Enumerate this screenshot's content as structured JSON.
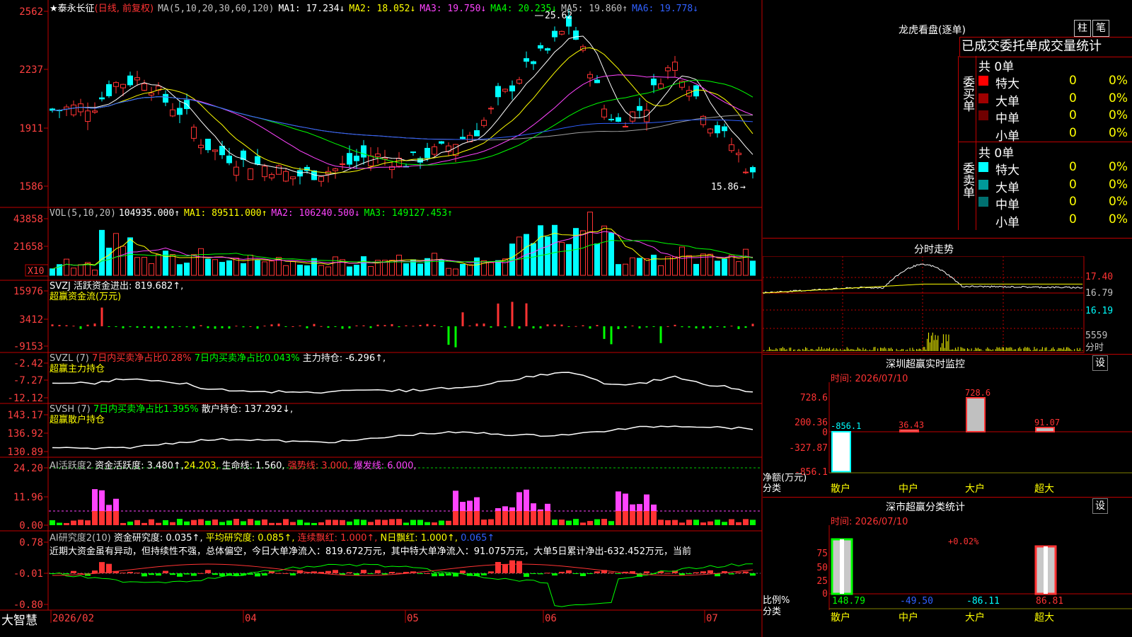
{
  "colors": {
    "up": "#ff3333",
    "down": "#00ffff",
    "grid": "#c00000",
    "yellow": "#ffff00",
    "magenta": "#ff44ff",
    "green": "#00ff00",
    "white": "#ffffff",
    "blue": "#3060ff",
    "gray": "#a0a0a0"
  },
  "header": {
    "stock": "★泰永长征",
    "period": "(日线, 前复权)",
    "ma_params": "MA(5,10,20,30,60,120)",
    "ma1": "MA1: 17.234↓",
    "ma2": "MA2: 18.052↓",
    "ma3": "MA3: 19.750↓",
    "ma4": "MA4: 20.235↓",
    "ma5": "MA5: 19.860↑",
    "ma6": "MA6: 19.778↓"
  },
  "price_axis": [
    "2562",
    "2237",
    "1911",
    "1586"
  ],
  "price_marks": {
    "high": "25.62",
    "low": "15.86"
  },
  "vol": {
    "axis": [
      "43858",
      "21658"
    ],
    "unit": "X10",
    "title": "VOL(5,10,20)",
    "v": "104935.000↑",
    "ma1": "MA1: 89511.000↑",
    "ma2": "MA2: 106240.500↓",
    "ma3": "MA3: 149127.453↑"
  },
  "svzj": {
    "axis": [
      "15976",
      "3412",
      "-9153"
    ],
    "line1": "SVZJ  活跃资金进出: 819.682↑,",
    "line2": "超赢资金流(万元)"
  },
  "svzl": {
    "axis": [
      "-2.42",
      "-7.27",
      "-12.12"
    ],
    "p1": "SVZL (7)",
    "p2": "7日内买卖净占比0.28%",
    "p3": "7日内买卖净占比0.043%",
    "p4": "主力持仓: -6.296↑,",
    "line2": "超赢主力持仓"
  },
  "svsh": {
    "axis": [
      "143.17",
      "136.92",
      "130.89"
    ],
    "p1": "SVSH (7)",
    "p2": "7日内买卖净占比1.395%",
    "p3": "散户持仓: 137.292↓,",
    "line2": "超赢散户持仓"
  },
  "ai1": {
    "axis": [
      "24.20",
      "11.96",
      "0.00"
    ],
    "p1": "AI活跃度2",
    "p2": "资金活跃度: 3.480↑,",
    "p3": "24.203,",
    "p4": "生命线: 1.560,",
    "p5": "强势线: 3.000,",
    "p6": "爆发线: 6.000,"
  },
  "ai2": {
    "axis": [
      "0.78",
      "-0.01",
      "-0.80"
    ],
    "p1": "AI研究度2(10)",
    "p2": "资金研究度: 0.035↑,",
    "p3": "平均研究度: 0.085↑,",
    "p4": "连续飘红: 1.000↑,",
    "p5": "N日飘红: 1.000↑,",
    "p6": "0.065↑",
    "comment": "近期大资金虽有异动，但持续性不强，总体偏空，今日大单净流入：819.672万元，其中特大单净流入：91.075万元，大单5日累计净出-632.452万元，当前"
  },
  "date_axis": [
    "2026/02",
    "04",
    "05",
    "06",
    "07"
  ],
  "brand": "大智慧",
  "right": {
    "lhb": {
      "title": "龙虎看盘(逐单)",
      "btn1": "柱",
      "btn2": "笔",
      "subtitle": "已成交委托单成交量统计",
      "buy": {
        "label": "委买单",
        "total": "共 0单",
        "rows": [
          {
            "name": "特大",
            "count": "0",
            "pct": "0%",
            "color": "#ff0000"
          },
          {
            "name": "大单",
            "count": "0",
            "pct": "0%",
            "color": "#a00000"
          },
          {
            "name": "中单",
            "count": "0",
            "pct": "0%",
            "color": "#700000"
          },
          {
            "name": "小单",
            "count": "0",
            "pct": "0%",
            "color": "#000000"
          }
        ]
      },
      "sell": {
        "label": "委卖单",
        "total": "共 0单",
        "rows": [
          {
            "name": "特大",
            "count": "0",
            "pct": "0%",
            "color": "#00ffff"
          },
          {
            "name": "大单",
            "count": "0",
            "pct": "0%",
            "color": "#009999"
          },
          {
            "name": "中单",
            "count": "0",
            "pct": "0%",
            "color": "#007070"
          },
          {
            "name": "小单",
            "count": "0",
            "pct": "0%",
            "color": "#000000"
          }
        ]
      }
    },
    "fenshi": {
      "title": "分时走势",
      "axis": [
        "17.40",
        "16.79",
        "16.19"
      ],
      "vol_axis": "5559",
      "vol_label": "分时"
    },
    "szmon": {
      "title": "深圳超赢实时监控",
      "set": "设",
      "time": "时间: 2026/07/10",
      "axis": [
        "728.6",
        "200.36",
        "0",
        "-327.87",
        "-856.1"
      ],
      "ylabel": "净额(万元)",
      "xlabel": "分类",
      "cats": [
        "散户",
        "中户",
        "大户",
        "超大"
      ],
      "values": [
        "-856.1",
        "36.43",
        "728.6",
        "91.07"
      ]
    },
    "szstat": {
      "title": "深市超赢分类统计",
      "set": "设",
      "time": "时间: 2026/07/10",
      "axis": [
        "75",
        "50",
        "25",
        "0"
      ],
      "ylabel": "比例%",
      "xlabel": "分类",
      "cats": [
        "散户",
        "中户",
        "大户",
        "超大"
      ],
      "values": [
        "148.79",
        "-49.50",
        "-86.11",
        "86.81"
      ],
      "top": "+0.02%"
    }
  }
}
